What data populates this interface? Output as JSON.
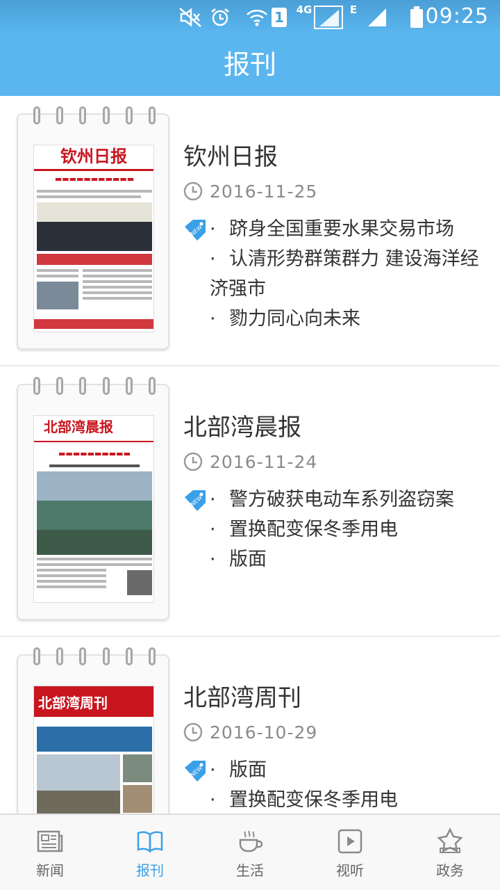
{
  "status_bar": {
    "time": "09:25",
    "network_label": "4G",
    "network2_label": "E",
    "sim_label": "1",
    "icons": [
      "mute-icon",
      "alarm-icon",
      "wifi-icon",
      "sim-icon",
      "signal-icon",
      "signal-icon",
      "battery-icon"
    ]
  },
  "header": {
    "title": "报刊"
  },
  "newspapers": [
    {
      "name": "钦州日报",
      "date": "2016-11-25",
      "masthead": "钦州日报",
      "badge": "NEW",
      "headlines": [
        "跻身全国重要水果交易市场",
        "认清形势群策群力 建设海洋经济强市",
        "勠力同心向未来"
      ]
    },
    {
      "name": "北部湾晨报",
      "date": "2016-11-24",
      "masthead": "北部湾晨报",
      "badge": "NEW",
      "headlines": [
        "警方破获电动车系列盗窃案",
        "置换配变保冬季用电",
        "版面"
      ]
    },
    {
      "name": "北部湾周刊",
      "date": "2016-10-29",
      "masthead": "北部湾周刊",
      "badge": "NEW",
      "headlines": [
        "版面",
        "置换配变保冬季用电"
      ]
    }
  ],
  "tabs": [
    {
      "label": "新闻",
      "icon": "newspaper-icon",
      "active": false
    },
    {
      "label": "报刊",
      "icon": "book-icon",
      "active": true
    },
    {
      "label": "生活",
      "icon": "coffee-cup-icon",
      "active": false
    },
    {
      "label": "视听",
      "icon": "play-icon",
      "active": false
    },
    {
      "label": "政务",
      "icon": "star-icon",
      "active": false
    }
  ],
  "colors": {
    "header": "#5bb6ef",
    "accent": "#3aa0e8",
    "tab_inactive": "#666666",
    "masthead_red": "#c9151e"
  }
}
